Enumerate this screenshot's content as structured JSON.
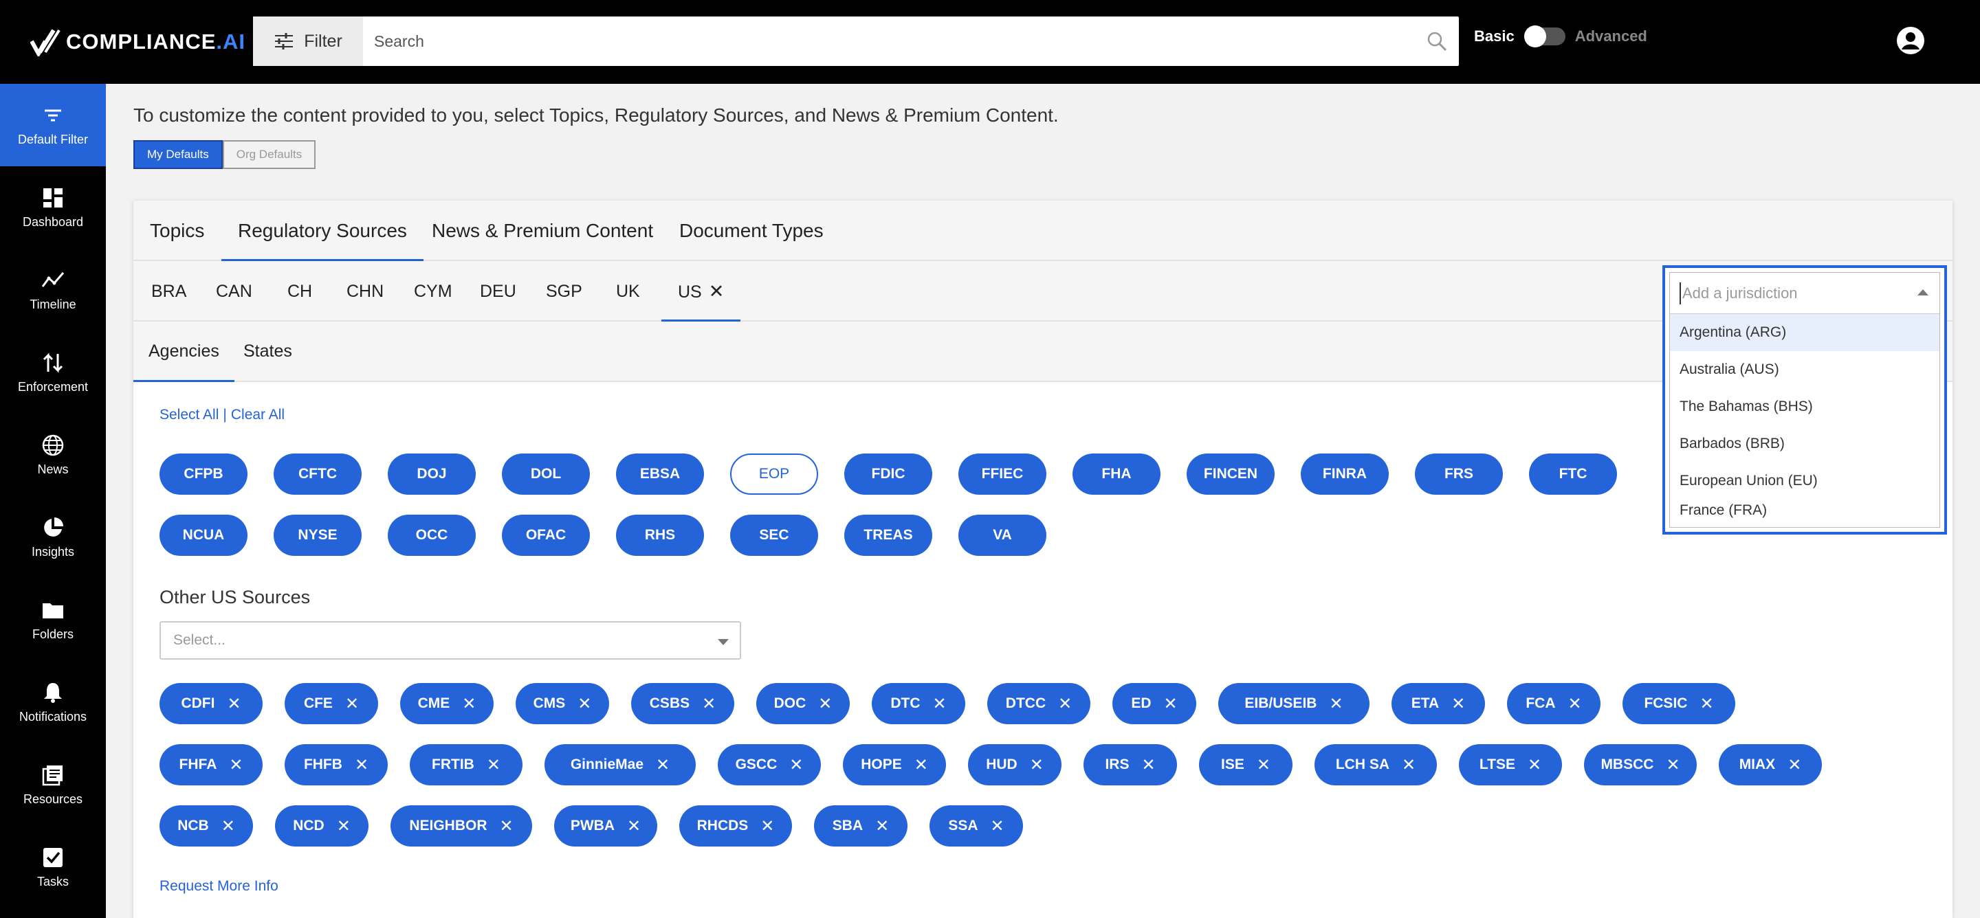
{
  "header": {
    "logo_main": "COMPLIANCE",
    "logo_dot": ".",
    "logo_ai": "AI",
    "filter_label": "Filter",
    "search_placeholder": "Search",
    "mode_basic": "Basic",
    "mode_advanced": "Advanced"
  },
  "sidebar": {
    "items": [
      {
        "label": "Default Filter",
        "icon": "filter-icon"
      },
      {
        "label": "Dashboard",
        "icon": "dashboard-icon"
      },
      {
        "label": "Timeline",
        "icon": "timeline-icon"
      },
      {
        "label": "Enforcement",
        "icon": "enforcement-icon"
      },
      {
        "label": "News",
        "icon": "globe-icon"
      },
      {
        "label": "Insights",
        "icon": "pie-chart-icon"
      },
      {
        "label": "Folders",
        "icon": "folder-icon"
      },
      {
        "label": "Notifications",
        "icon": "bell-icon"
      },
      {
        "label": "Resources",
        "icon": "resources-icon"
      },
      {
        "label": "Tasks",
        "icon": "checkbox-icon"
      }
    ]
  },
  "main": {
    "intro": "To customize the content provided to you, select Topics, Regulatory Sources, and News & Premium Content.",
    "my_defaults": "My Defaults",
    "org_defaults": "Org Defaults",
    "tabs": [
      "Topics",
      "Regulatory Sources",
      "News & Premium Content",
      "Document Types"
    ],
    "jurisdictions": [
      "BRA",
      "CAN",
      "CH",
      "CHN",
      "CYM",
      "DEU",
      "SGP",
      "UK",
      "US"
    ],
    "close_glyph": "✕",
    "subtabs": [
      "Agencies",
      "States"
    ],
    "select_all": "Select All",
    "separator": "|",
    "clear_all": "Clear All",
    "agencies_row1": [
      "CFPB",
      "CFTC",
      "DOJ",
      "DOL",
      "EBSA",
      "EOP",
      "FDIC",
      "FFIEC",
      "FHA",
      "FINCEN",
      "FINRA",
      "FRS",
      "FTC"
    ],
    "agencies_row2": [
      "NCUA",
      "NYSE",
      "OCC",
      "OFAC",
      "RHS",
      "SEC",
      "TREAS",
      "VA"
    ],
    "other_label": "Other US Sources",
    "other_placeholder": "Select...",
    "other_row1": [
      "CDFI",
      "CFE",
      "CME",
      "CMS",
      "CSBS",
      "DOC",
      "DTC",
      "DTCC",
      "ED",
      "EIB/USEIB",
      "ETA",
      "FCA",
      "FCSIC"
    ],
    "other_row2": [
      "FHFA",
      "FHFB",
      "FRTIB",
      "GinnieMae",
      "GSCC",
      "HOPE",
      "HUD",
      "IRS",
      "ISE",
      "LCH SA",
      "LTSE",
      "MBSCC",
      "MIAX"
    ],
    "other_row3": [
      "NCB",
      "NCD",
      "NEIGHBOR",
      "PWBA",
      "RHCDS",
      "SBA",
      "SSA"
    ],
    "request_more": "Request More Info"
  },
  "jurisdiction_dropdown": {
    "placeholder": "Add a jurisdiction",
    "options": [
      "Argentina (ARG)",
      "Australia (AUS)",
      "The Bahamas (BHS)",
      "Barbados (BRB)",
      "European Union (EU)",
      "France (FRA)"
    ]
  },
  "colors": {
    "accent": "#2563d8",
    "header_bg": "#000000",
    "page_bg": "#f2f2f2"
  }
}
